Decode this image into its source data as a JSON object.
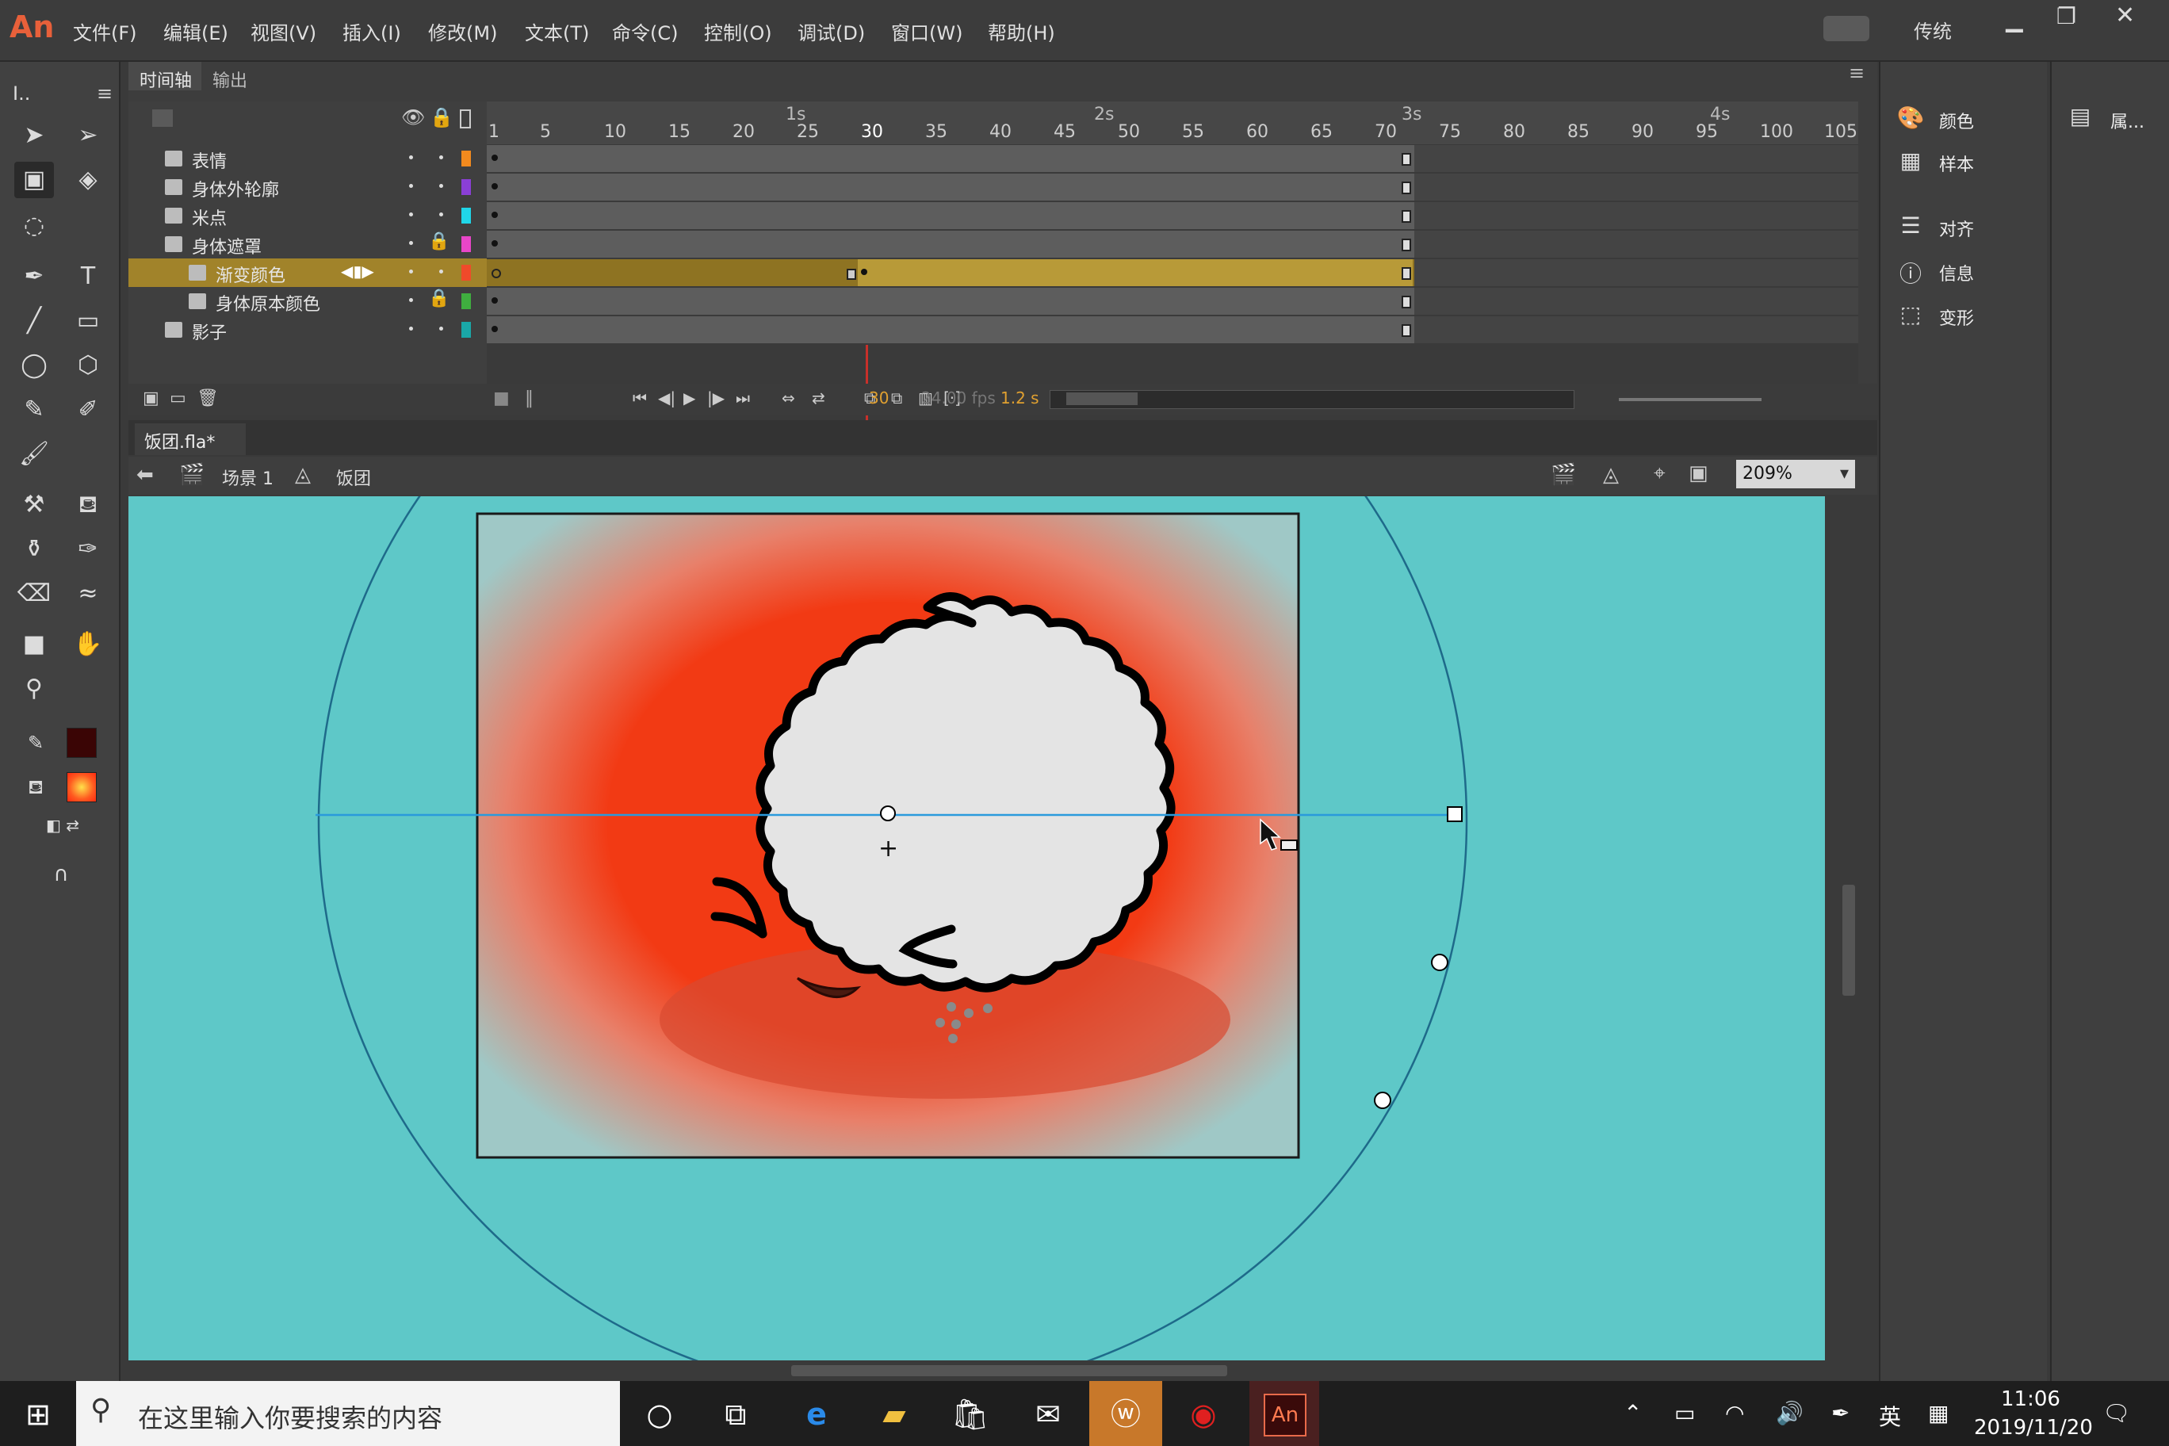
{
  "app": {
    "logo": "An"
  },
  "menu": [
    "文件(F)",
    "编辑(E)",
    "视图(V)",
    "插入(I)",
    "修改(M)",
    "文本(T)",
    "命令(C)",
    "控制(O)",
    "调试(D)",
    "窗口(W)",
    "帮助(H)"
  ],
  "workspace": {
    "label": "传统"
  },
  "tools_panel": {
    "tool_label": "I.."
  },
  "timeline": {
    "tabs": [
      "时间轴",
      "输出"
    ],
    "layers": [
      {
        "name": "表情",
        "color": "#f28a1e",
        "locked": false
      },
      {
        "name": "身体外轮廓",
        "color": "#8a3fd6",
        "locked": false
      },
      {
        "name": "米点",
        "color": "#20d6e8",
        "locked": false
      },
      {
        "name": "身体遮罩",
        "color": "#e846c8",
        "locked": true
      },
      {
        "name": "渐变颜色",
        "color": "#f04a2a",
        "locked": false,
        "selected": true
      },
      {
        "name": "身体原本颜色",
        "color": "#3fae3f",
        "locked": true
      },
      {
        "name": "影子",
        "color": "#1aa8a8",
        "locked": false
      }
    ],
    "ruler_ticks": [
      "1",
      "5",
      "10",
      "15",
      "20",
      "25",
      "30",
      "35",
      "40",
      "45",
      "50",
      "55",
      "60",
      "65",
      "70",
      "75",
      "80",
      "85",
      "90",
      "95",
      "100",
      "105"
    ],
    "seconds": [
      "1s",
      "2s",
      "3s",
      "4s"
    ],
    "current_frame": "30",
    "fps": "24.00 fps",
    "elapsed": "1.2 s"
  },
  "document": {
    "tab": "饭团.fla*",
    "breadcrumb_scene": "场景 1",
    "breadcrumb_symbol": "饭团",
    "zoom": "209%"
  },
  "right_panel": {
    "items": [
      "颜色",
      "样本",
      "对齐",
      "信息",
      "变形"
    ],
    "properties": "属..."
  },
  "taskbar": {
    "search_placeholder": "在这里输入你要搜索的内容",
    "ime": "英",
    "time": "11:06",
    "date": "2019/11/20"
  },
  "colors": {
    "stage_bg": "#5ec8c8",
    "gradient_center": "#f23a14",
    "gradient_edge": "#9fc8c6",
    "stroke_color": "#3a0505",
    "fill_color": "#ff5a20",
    "layer_selected": "#a1832a"
  }
}
